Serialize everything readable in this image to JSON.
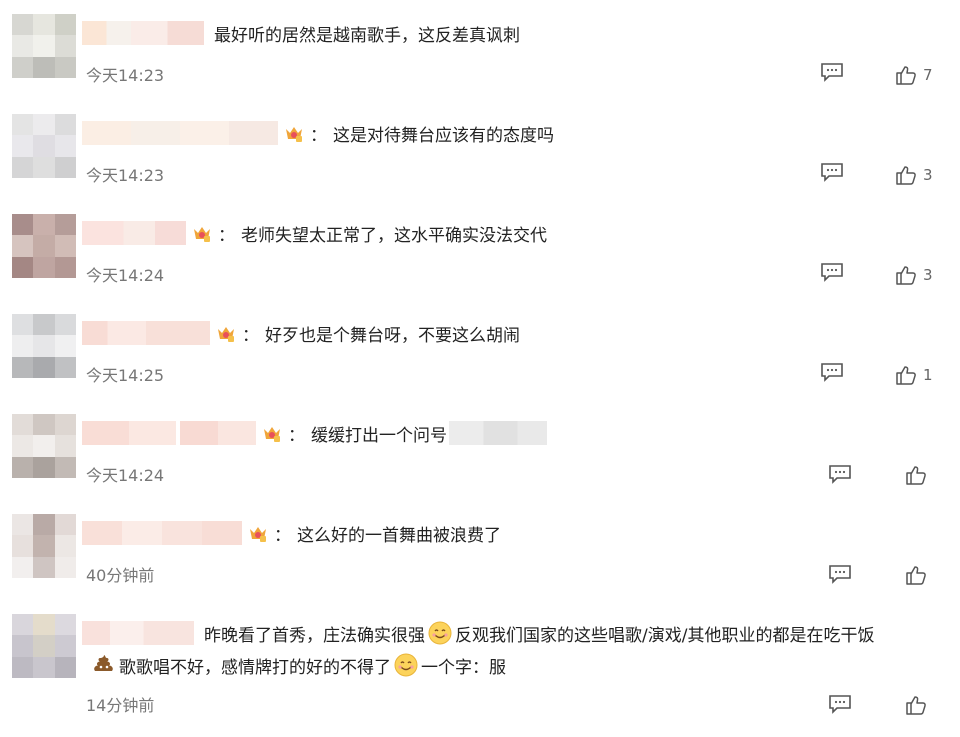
{
  "comments": [
    {
      "text": "最好听的居然是越南歌手，这反差真讽刺",
      "time": "今天14:23",
      "likes": "7",
      "has_crown": false
    },
    {
      "text": "这是对待舞台应该有的态度吗",
      "time": "今天14:23",
      "likes": "3",
      "has_crown": true
    },
    {
      "text": "老师失望太正常了，这水平确实没法交代",
      "time": "今天14:24",
      "likes": "3",
      "has_crown": true
    },
    {
      "text": "好歹也是个舞台呀，不要这么胡闹",
      "time": "今天14:25",
      "likes": "1",
      "has_crown": true
    },
    {
      "text": "缓缓打出一个问号",
      "time": "今天14:24",
      "likes": "",
      "has_crown": true
    },
    {
      "text": "这么好的一首舞曲被浪费了",
      "time": "40分钟前",
      "likes": "",
      "has_crown": true
    },
    {
      "text_part1": "昨晚看了首秀，庄法确实很强",
      "text_part2": "反观我们国家的这些唱歌/演戏/其他职业的都是在吃干饭",
      "text_part3": "歌歌唱不好，感情牌打的好的不得了",
      "text_part4": "一个字：服",
      "time": "14分钟前",
      "likes": "",
      "has_crown": false
    }
  ],
  "colon": "：",
  "icons": {
    "reply": "comment-icon",
    "like": "thumbs-up-icon",
    "crown": "crown-badge-icon",
    "smile": "smile-emoji-icon",
    "poop": "poop-emoji-icon"
  },
  "colors": {
    "text": "#222222",
    "meta": "#777777",
    "icon": "#555555"
  }
}
